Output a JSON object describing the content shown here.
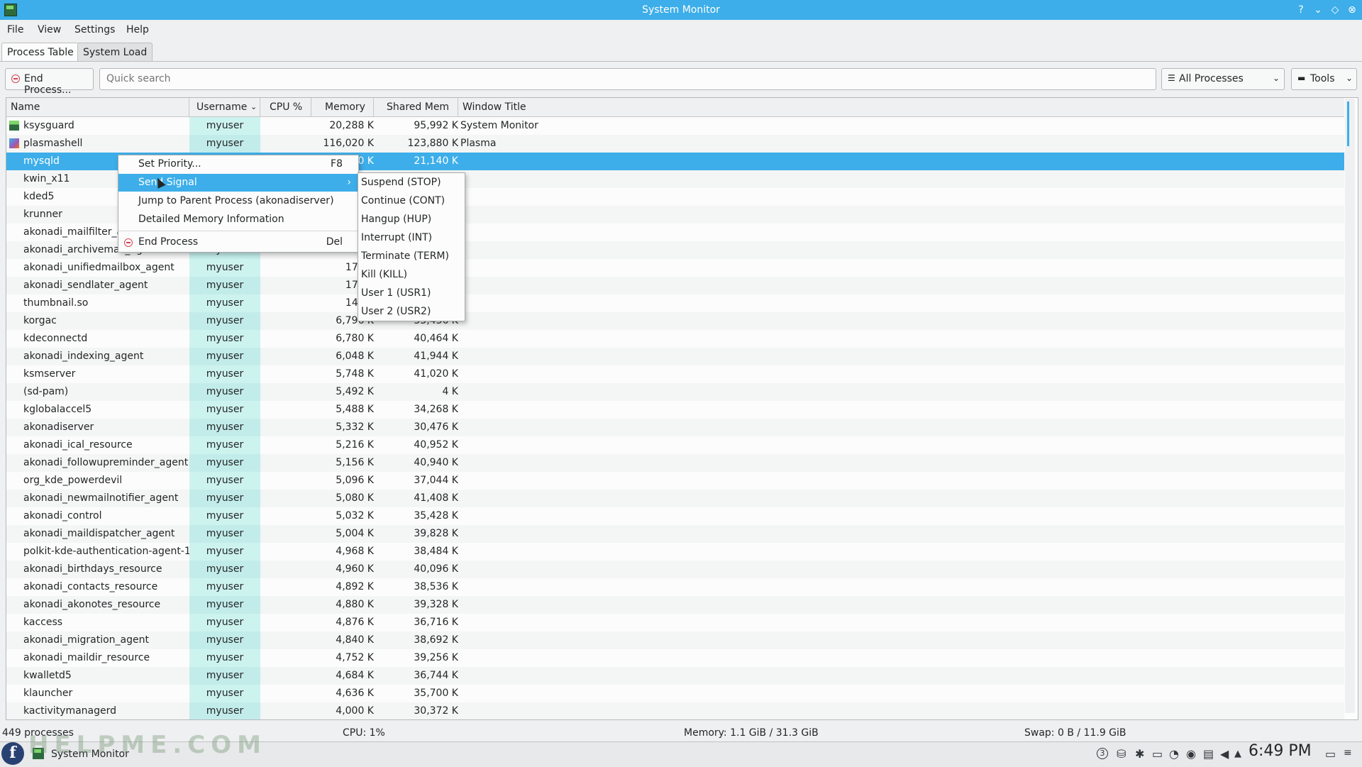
{
  "window": {
    "title": "System Monitor",
    "buttons": [
      "?",
      "⌄",
      "◇",
      "⊗"
    ]
  },
  "menubar": [
    "File",
    "View",
    "Settings",
    "Help"
  ],
  "tabs": [
    {
      "label": "Process Table"
    },
    {
      "label": "System Load"
    }
  ],
  "toolbar": {
    "end_process_label": "End Process...",
    "search_placeholder": "Quick search",
    "filter_label": "All Processes",
    "tools_label": "Tools"
  },
  "table": {
    "headers": [
      "Name",
      "Username",
      "CPU %",
      "Memory",
      "Shared Mem",
      "Window Title"
    ],
    "rows": [
      {
        "name": "ksysguard",
        "user": "myuser",
        "cpu": "",
        "mem": "20,288 K",
        "shr": "95,992 K",
        "win": "System Monitor",
        "icon": "ksysguard"
      },
      {
        "name": "plasmashell",
        "user": "myuser",
        "cpu": "",
        "mem": "116,020 K",
        "shr": "123,880 K",
        "win": "Plasma",
        "icon": "plasma"
      },
      {
        "name": "mysqld",
        "user": "",
        "cpu": "",
        "mem": "0 K",
        "shr": "21,140 K",
        "win": "",
        "selected": true
      },
      {
        "name": "kwin_x11",
        "user": "",
        "cpu": "",
        "mem": "",
        "shr": "",
        "win": ""
      },
      {
        "name": "kded5",
        "user": "",
        "cpu": "",
        "mem": "",
        "shr": "",
        "win": ""
      },
      {
        "name": "krunner",
        "user": "",
        "cpu": "",
        "mem": "",
        "shr": "",
        "win": ""
      },
      {
        "name": "akonadi_mailfilter_ag",
        "user": "",
        "cpu": "",
        "mem": "",
        "shr": "",
        "win": ""
      },
      {
        "name": "akonadi_archivemail_agent",
        "user": "myuser",
        "cpu": "",
        "mem": "17,68",
        "shr": "",
        "win": ""
      },
      {
        "name": "akonadi_unifiedmailbox_agent",
        "user": "myuser",
        "cpu": "",
        "mem": "17,68",
        "shr": "",
        "win": ""
      },
      {
        "name": "akonadi_sendlater_agent",
        "user": "myuser",
        "cpu": "",
        "mem": "17,57",
        "shr": "",
        "win": ""
      },
      {
        "name": "thumbnail.so",
        "user": "myuser",
        "cpu": "",
        "mem": "14,59",
        "shr": "",
        "win": ""
      },
      {
        "name": "korgac",
        "user": "myuser",
        "cpu": "",
        "mem": "6,796 K",
        "shr": "33,436 K",
        "win": ""
      },
      {
        "name": "kdeconnectd",
        "user": "myuser",
        "cpu": "",
        "mem": "6,780 K",
        "shr": "40,464 K",
        "win": ""
      },
      {
        "name": "akonadi_indexing_agent",
        "user": "myuser",
        "cpu": "",
        "mem": "6,048 K",
        "shr": "41,944 K",
        "win": ""
      },
      {
        "name": "ksmserver",
        "user": "myuser",
        "cpu": "",
        "mem": "5,748 K",
        "shr": "41,020 K",
        "win": ""
      },
      {
        "name": "(sd-pam)",
        "user": "myuser",
        "cpu": "",
        "mem": "5,492 K",
        "shr": "4 K",
        "win": ""
      },
      {
        "name": "kglobalaccel5",
        "user": "myuser",
        "cpu": "",
        "mem": "5,488 K",
        "shr": "34,268 K",
        "win": ""
      },
      {
        "name": "akonadiserver",
        "user": "myuser",
        "cpu": "",
        "mem": "5,332 K",
        "shr": "30,476 K",
        "win": ""
      },
      {
        "name": "akonadi_ical_resource",
        "user": "myuser",
        "cpu": "",
        "mem": "5,216 K",
        "shr": "40,952 K",
        "win": ""
      },
      {
        "name": "akonadi_followupreminder_agent",
        "user": "myuser",
        "cpu": "",
        "mem": "5,156 K",
        "shr": "40,940 K",
        "win": ""
      },
      {
        "name": "org_kde_powerdevil",
        "user": "myuser",
        "cpu": "",
        "mem": "5,096 K",
        "shr": "37,044 K",
        "win": ""
      },
      {
        "name": "akonadi_newmailnotifier_agent",
        "user": "myuser",
        "cpu": "",
        "mem": "5,080 K",
        "shr": "41,408 K",
        "win": ""
      },
      {
        "name": "akonadi_control",
        "user": "myuser",
        "cpu": "",
        "mem": "5,032 K",
        "shr": "35,428 K",
        "win": ""
      },
      {
        "name": "akonadi_maildispatcher_agent",
        "user": "myuser",
        "cpu": "",
        "mem": "5,004 K",
        "shr": "39,828 K",
        "win": ""
      },
      {
        "name": "polkit-kde-authentication-agent-1",
        "user": "myuser",
        "cpu": "",
        "mem": "4,968 K",
        "shr": "38,484 K",
        "win": ""
      },
      {
        "name": "akonadi_birthdays_resource",
        "user": "myuser",
        "cpu": "",
        "mem": "4,960 K",
        "shr": "40,096 K",
        "win": ""
      },
      {
        "name": "akonadi_contacts_resource",
        "user": "myuser",
        "cpu": "",
        "mem": "4,892 K",
        "shr": "38,536 K",
        "win": ""
      },
      {
        "name": "akonadi_akonotes_resource",
        "user": "myuser",
        "cpu": "",
        "mem": "4,880 K",
        "shr": "39,328 K",
        "win": ""
      },
      {
        "name": "kaccess",
        "user": "myuser",
        "cpu": "",
        "mem": "4,876 K",
        "shr": "36,716 K",
        "win": ""
      },
      {
        "name": "akonadi_migration_agent",
        "user": "myuser",
        "cpu": "",
        "mem": "4,840 K",
        "shr": "38,692 K",
        "win": ""
      },
      {
        "name": "akonadi_maildir_resource",
        "user": "myuser",
        "cpu": "",
        "mem": "4,752 K",
        "shr": "39,256 K",
        "win": ""
      },
      {
        "name": "kwalletd5",
        "user": "myuser",
        "cpu": "",
        "mem": "4,684 K",
        "shr": "36,744 K",
        "win": ""
      },
      {
        "name": "klauncher",
        "user": "myuser",
        "cpu": "",
        "mem": "4,636 K",
        "shr": "35,700 K",
        "win": ""
      },
      {
        "name": "kactivitymanagerd",
        "user": "myuser",
        "cpu": "",
        "mem": "4,000 K",
        "shr": "30,372 K",
        "win": ""
      }
    ]
  },
  "context_menu": {
    "items": [
      {
        "label": "Set Priority...",
        "shortcut": "F8"
      },
      {
        "label": "Send Signal",
        "shortcut": "›",
        "highlighted": true
      },
      {
        "label": "Jump to Parent Process (akonadiserver)",
        "shortcut": ""
      },
      {
        "label": "Detailed Memory Information",
        "shortcut": ""
      },
      {
        "label": "End Process",
        "shortcut": "Del"
      }
    ],
    "submenu": [
      "Suspend (STOP)",
      "Continue (CONT)",
      "Hangup (HUP)",
      "Interrupt (INT)",
      "Terminate (TERM)",
      "Kill (KILL)",
      "User 1 (USR1)",
      "User 2 (USR2)"
    ]
  },
  "statusbar": {
    "processes": "449 processes",
    "cpu": "CPU: 1%",
    "memory": "Memory: 1.1 GiB / 31.3 GiB",
    "swap": "Swap: 0 B / 11.9 GiB"
  },
  "taskbar": {
    "launcher": "f",
    "task": "System Monitor",
    "clock": "6:49 PM",
    "tray_badge": "3"
  },
  "watermark": "HELPME.COM",
  "colors": {
    "accent": "#3daee9",
    "user_column": "#cdf3ef",
    "danger": "#da4453"
  }
}
